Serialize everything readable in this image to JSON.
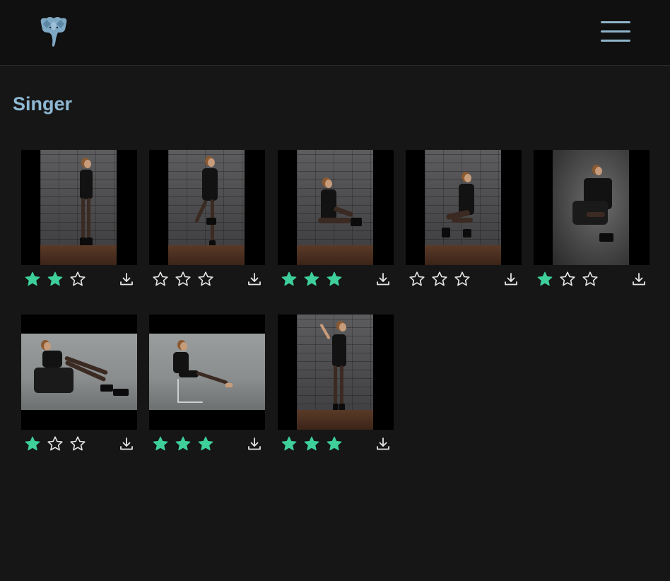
{
  "page": {
    "title": "Singer"
  },
  "header": {
    "logo_icon": "elephant-icon",
    "menu_icon": "hamburger-menu-icon"
  },
  "colors": {
    "background": "#161616",
    "header_background": "#101010",
    "title": "#8eb8d3",
    "star_filled": "#3ecf9b",
    "star_empty_outline": "#e6e6e6",
    "menu_icon": "#8fb4c9"
  },
  "photos": [
    {
      "rating": 2,
      "max_rating": 3,
      "download_icon": "download-icon"
    },
    {
      "rating": 0,
      "max_rating": 3,
      "download_icon": "download-icon"
    },
    {
      "rating": 3,
      "max_rating": 3,
      "download_icon": "download-icon"
    },
    {
      "rating": 0,
      "max_rating": 3,
      "download_icon": "download-icon"
    },
    {
      "rating": 1,
      "max_rating": 3,
      "download_icon": "download-icon"
    },
    {
      "rating": 1,
      "max_rating": 3,
      "download_icon": "download-icon"
    },
    {
      "rating": 3,
      "max_rating": 3,
      "download_icon": "download-icon"
    },
    {
      "rating": 3,
      "max_rating": 3,
      "download_icon": "download-icon"
    }
  ]
}
